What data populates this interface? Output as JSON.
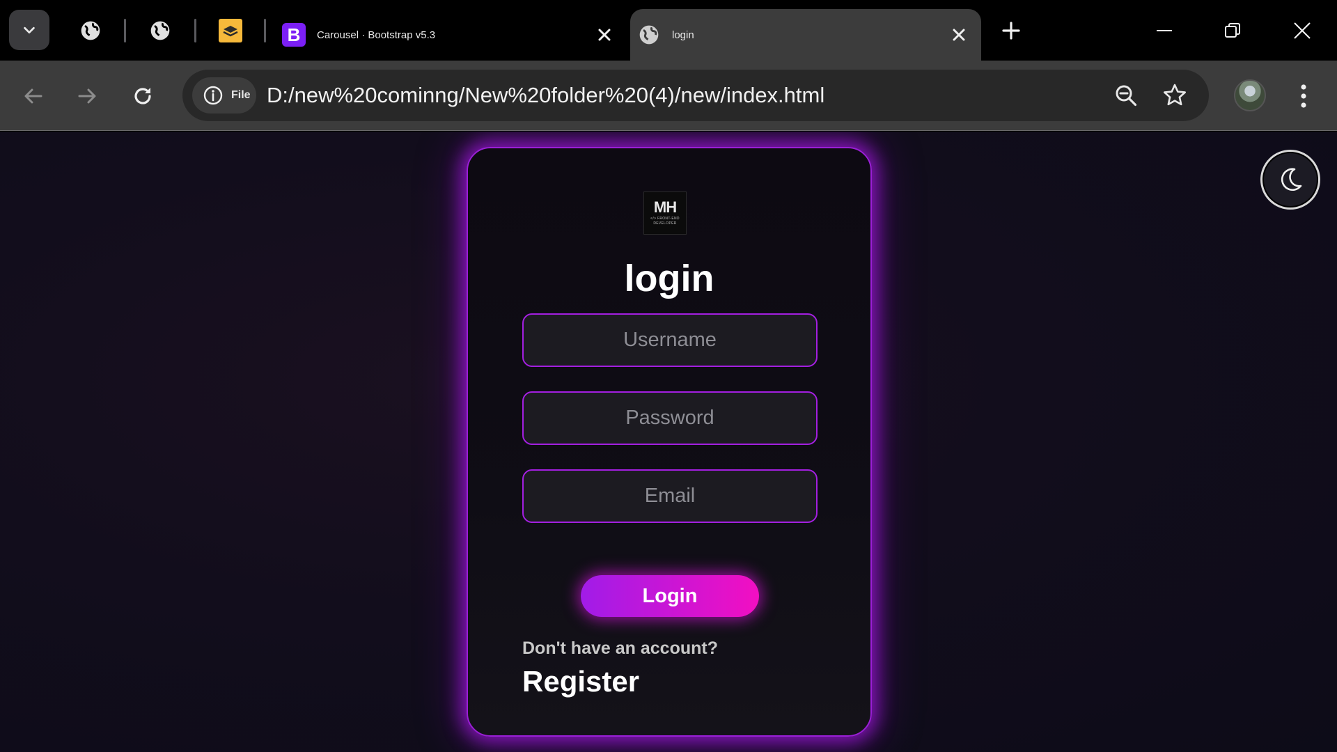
{
  "browser": {
    "tabs": [
      {
        "title": "Carousel · Bootstrap v5.3",
        "favicon": "bootstrap-logo-icon",
        "favicon_letter": "B",
        "active": false
      },
      {
        "title": "login",
        "favicon": "globe-icon",
        "active": true
      }
    ],
    "pinned_tabs": [
      "globe-icon",
      "globe-icon",
      "layers-icon"
    ],
    "address_chip_label": "File",
    "url": "D:/new%20cominng/New%20folder%20(4)/new/index.html"
  },
  "page": {
    "logo": {
      "text": "MH",
      "subtitle": "</> FRONT-END DEVELOPER"
    },
    "heading": "login",
    "fields": {
      "username_placeholder": "Username",
      "password_placeholder": "Password",
      "email_placeholder": "Email"
    },
    "login_button": "Login",
    "account_prompt": "Don't have an account?",
    "register_link": "Register",
    "theme_toggle_icon": "moon-icon"
  },
  "colors": {
    "accent_purple": "#a31fe0",
    "button_gradient_start": "#a11ce8",
    "button_gradient_end": "#f20fc2",
    "page_background": "#120d1c"
  }
}
